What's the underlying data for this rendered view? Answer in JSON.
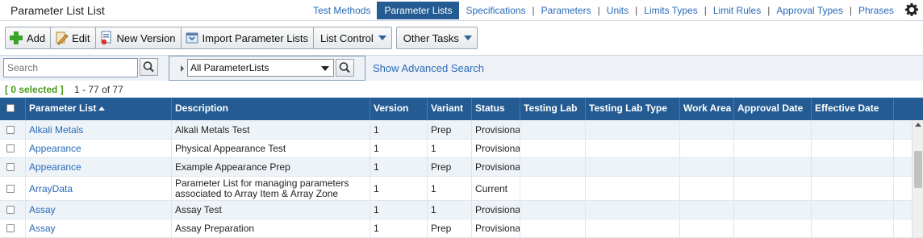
{
  "header": {
    "title": "Parameter List List",
    "nav": [
      {
        "label": "Test Methods",
        "active": false
      },
      {
        "label": "Parameter Lists",
        "active": true
      },
      {
        "label": "Specifications",
        "active": false
      },
      {
        "label": "Parameters",
        "active": false
      },
      {
        "label": "Units",
        "active": false
      },
      {
        "label": "Limits Types",
        "active": false
      },
      {
        "label": "Limit Rules",
        "active": false
      },
      {
        "label": "Approval Types",
        "active": false
      },
      {
        "label": "Phrases",
        "active": false
      }
    ],
    "settings_icon": "gear-icon"
  },
  "toolbar": {
    "add_label": "Add",
    "edit_label": "Edit",
    "new_version_label": "New Version",
    "import_label": "Import Parameter Lists",
    "list_control_label": "List Control",
    "other_tasks_label": "Other Tasks"
  },
  "search": {
    "placeholder": "Search",
    "filter_value": "All ParameterLists",
    "advanced_label": "Show Advanced Search"
  },
  "selection": {
    "selected_text": "[ 0 selected ]",
    "range_text": "1 - 77 of 77"
  },
  "grid": {
    "columns": [
      "Parameter List",
      "Description",
      "Version",
      "Variant",
      "Status",
      "Testing Lab",
      "Testing Lab Type",
      "Work Area",
      "Approval Date",
      "Effective Date"
    ],
    "rows": [
      {
        "name": "Alkali Metals",
        "desc": "Alkali Metals Test",
        "version": "1",
        "variant": "Prep",
        "status": "Provisional"
      },
      {
        "name": "Appearance",
        "desc": "Physical Appearance Test",
        "version": "1",
        "variant": "1",
        "status": "Provisional"
      },
      {
        "name": "Appearance",
        "desc": "Example Appearance Prep",
        "version": "1",
        "variant": "Prep",
        "status": "Provisional"
      },
      {
        "name": "ArrayData",
        "desc": "Parameter List for managing parameters associated to Array Item & Array Zone",
        "version": "1",
        "variant": "1",
        "status": "Current"
      },
      {
        "name": "Assay",
        "desc": "Assay Test",
        "version": "1",
        "variant": "1",
        "status": "Provisional"
      },
      {
        "name": "Assay",
        "desc": "Assay Preparation",
        "version": "1",
        "variant": "Prep",
        "status": "Provisional"
      }
    ]
  },
  "colors": {
    "header_blue": "#235b92",
    "link_blue": "#2a6ab8",
    "selected_green": "#4a9a1a"
  }
}
